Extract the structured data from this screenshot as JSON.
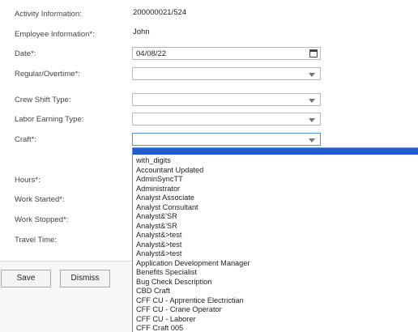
{
  "form": {
    "activity_label": "Activity Information:",
    "activity_value": "200000021/524",
    "employee_label": "Employee Information*:",
    "employee_value": "John",
    "date_label": "Date*:",
    "date_value": "04/08/22",
    "regular_label": "Regular/Overtime*:",
    "crew_label": "Crew Shift Type:",
    "earning_label": "Labor Earning Type:",
    "craft_label": "Craft*:",
    "hours_label": "Hours*:",
    "started_label": "Work Started*:",
    "stopped_label": "Work Stopped*:",
    "travel_label": "Travel Time:"
  },
  "buttons": {
    "save": "Save",
    "dismiss": "Dismiss"
  },
  "craft_options": [
    "with_digits",
    "Accountant Updated",
    "AdminSyncTT",
    "Administrator",
    "Analyst Associate",
    "Analyst Consultant",
    "Analyst&'SR",
    "Analyst&'SR",
    "Analyst&>test",
    "Analyst&>test",
    "Analyst&>test",
    "Application Development Manager",
    "Benefits Specialist",
    "Bug Check Description",
    "CBD Craft",
    "CFF CU - Apprentice Electrictian",
    "CFF CU - Crane Operator",
    "CFF CU - Laborer",
    "CFF Craft 005"
  ],
  "icons": {
    "calendar": "calendar-icon",
    "dropdown": "chevron-down-icon"
  }
}
